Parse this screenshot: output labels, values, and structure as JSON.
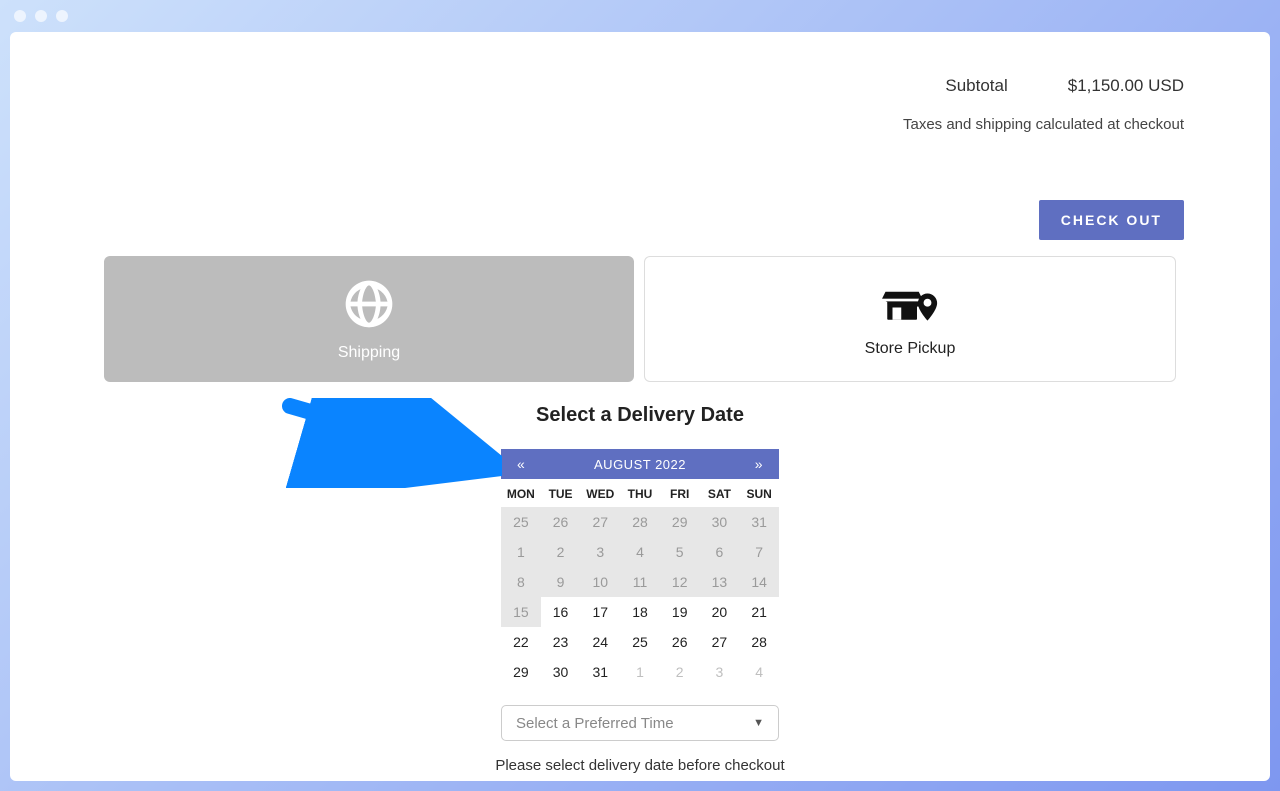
{
  "summary": {
    "subtotal_label": "Subtotal",
    "subtotal_value": "$1,150.00 USD",
    "tax_note": "Taxes and shipping calculated at checkout",
    "checkout_label": "CHECK OUT"
  },
  "methods": {
    "shipping": {
      "label": "Shipping"
    },
    "pickup": {
      "label": "Store Pickup"
    }
  },
  "delivery": {
    "title": "Select a Delivery Date",
    "calendar": {
      "prev": "«",
      "next": "»",
      "month_label": "AUGUST 2022",
      "dow": [
        "MON",
        "TUE",
        "WED",
        "THU",
        "FRI",
        "SAT",
        "SUN"
      ],
      "weeks": [
        [
          {
            "d": "25",
            "state": "disabled"
          },
          {
            "d": "26",
            "state": "disabled"
          },
          {
            "d": "27",
            "state": "disabled"
          },
          {
            "d": "28",
            "state": "disabled"
          },
          {
            "d": "29",
            "state": "disabled"
          },
          {
            "d": "30",
            "state": "disabled"
          },
          {
            "d": "31",
            "state": "disabled"
          }
        ],
        [
          {
            "d": "1",
            "state": "disabled"
          },
          {
            "d": "2",
            "state": "disabled"
          },
          {
            "d": "3",
            "state": "disabled"
          },
          {
            "d": "4",
            "state": "disabled"
          },
          {
            "d": "5",
            "state": "disabled"
          },
          {
            "d": "6",
            "state": "disabled"
          },
          {
            "d": "7",
            "state": "disabled"
          }
        ],
        [
          {
            "d": "8",
            "state": "disabled"
          },
          {
            "d": "9",
            "state": "disabled"
          },
          {
            "d": "10",
            "state": "disabled"
          },
          {
            "d": "11",
            "state": "disabled"
          },
          {
            "d": "12",
            "state": "disabled"
          },
          {
            "d": "13",
            "state": "disabled"
          },
          {
            "d": "14",
            "state": "disabled"
          }
        ],
        [
          {
            "d": "15",
            "state": "disabled"
          },
          {
            "d": "16",
            "state": "enabled"
          },
          {
            "d": "17",
            "state": "enabled"
          },
          {
            "d": "18",
            "state": "enabled"
          },
          {
            "d": "19",
            "state": "enabled"
          },
          {
            "d": "20",
            "state": "enabled"
          },
          {
            "d": "21",
            "state": "enabled"
          }
        ],
        [
          {
            "d": "22",
            "state": "enabled"
          },
          {
            "d": "23",
            "state": "enabled"
          },
          {
            "d": "24",
            "state": "enabled"
          },
          {
            "d": "25",
            "state": "enabled"
          },
          {
            "d": "26",
            "state": "enabled"
          },
          {
            "d": "27",
            "state": "enabled"
          },
          {
            "d": "28",
            "state": "enabled"
          }
        ],
        [
          {
            "d": "29",
            "state": "enabled"
          },
          {
            "d": "30",
            "state": "enabled"
          },
          {
            "d": "31",
            "state": "enabled"
          },
          {
            "d": "1",
            "state": "other-month"
          },
          {
            "d": "2",
            "state": "other-month"
          },
          {
            "d": "3",
            "state": "other-month"
          },
          {
            "d": "4",
            "state": "other-month"
          }
        ]
      ]
    },
    "time_placeholder": "Select a Preferred Time",
    "helper": "Please select delivery date before checkout"
  }
}
